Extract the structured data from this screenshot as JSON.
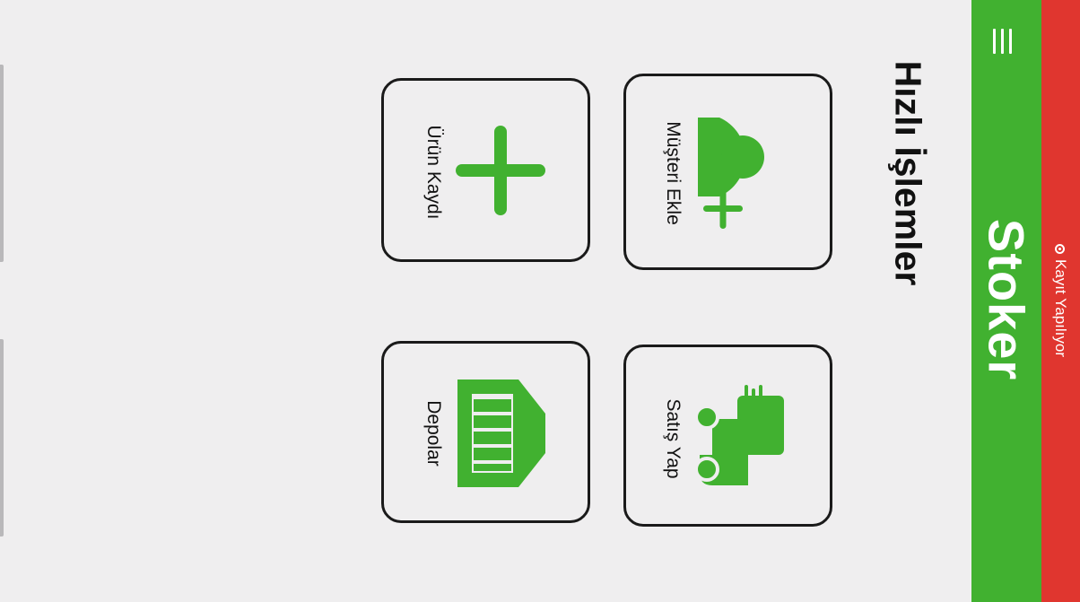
{
  "status": {
    "recording_text": "Kayıt Yapılıyor",
    "recording_color": "#e0362f"
  },
  "app_bar": {
    "title": "Stoker",
    "color": "#41b130",
    "menu_icon": "hamburger-menu-icon"
  },
  "quick_actions": {
    "title": "Hızlı İşlemler",
    "accent_color": "#41b130",
    "items": [
      {
        "label": "Müşteri Ekle",
        "icon": "add-person-icon"
      },
      {
        "label": "Satış Yap",
        "icon": "delivery-truck-icon"
      },
      {
        "label": "Ürün Kaydı",
        "icon": "plus-icon"
      },
      {
        "label": "Depolar",
        "icon": "warehouse-icon"
      }
    ]
  }
}
